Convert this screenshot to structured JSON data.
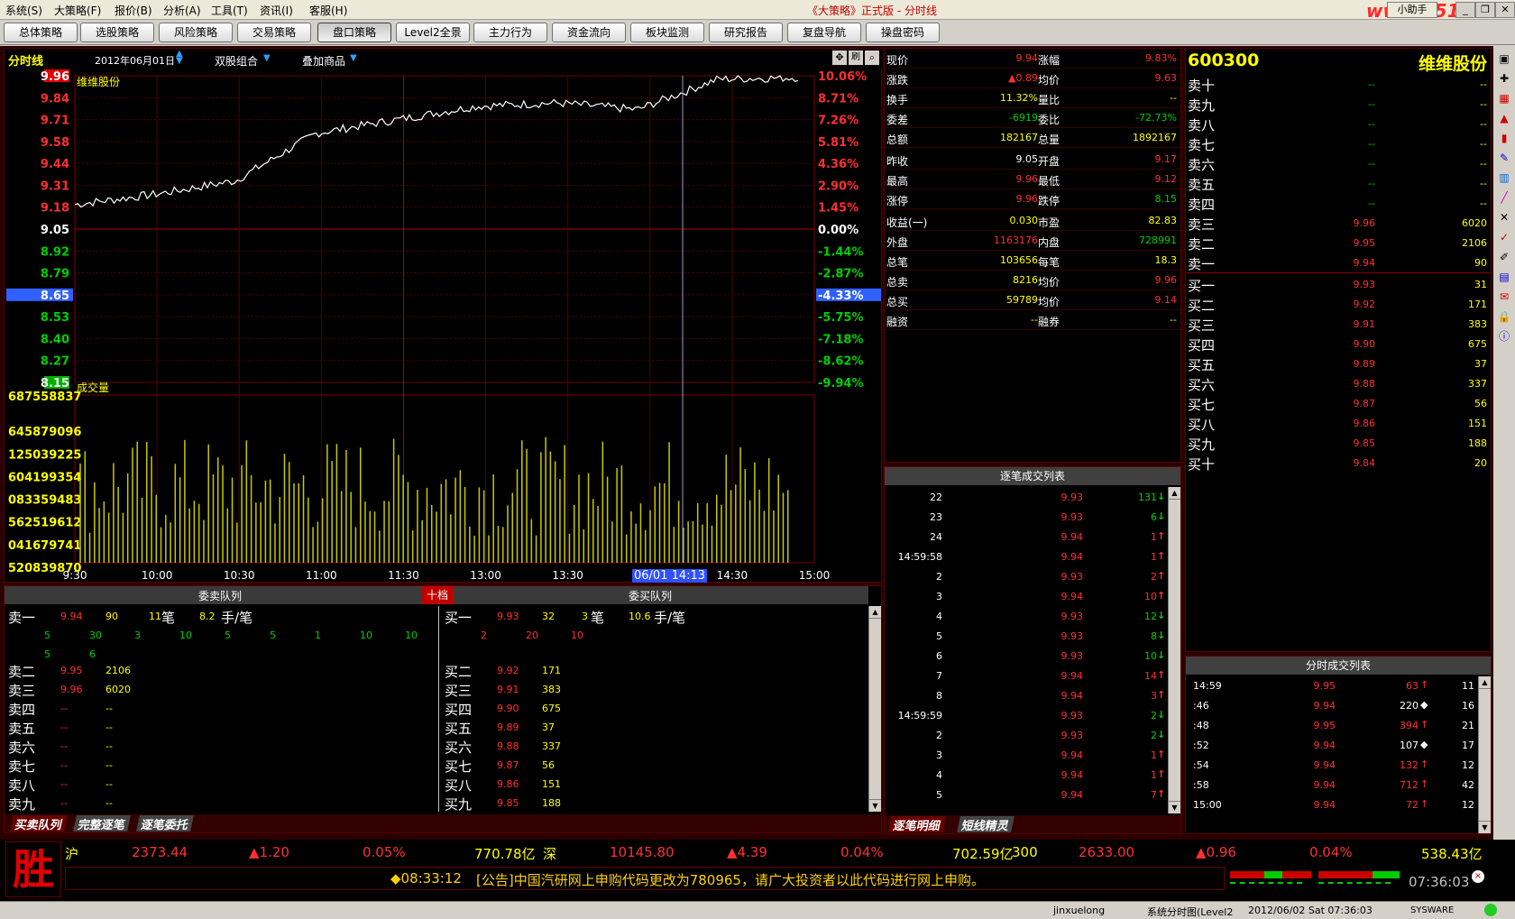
{
  "menu": [
    "系统(S)",
    "大策略(F)",
    "报价(B)",
    "分析(A)",
    "工具(T)",
    "资讯(I)",
    "客服(H)"
  ],
  "app_title": "《大策略》正式版 - 分时线",
  "logo_text": "www.55188.com",
  "helper_label": "小助手",
  "toolbar": [
    "总体策略",
    "选股策略",
    "风险策略",
    "交易策略",
    "盘口策略",
    "Level2全景",
    "主力行为",
    "资金流向",
    "板块监测",
    "研究报告",
    "复盘导航",
    "操盘密码"
  ],
  "toolbar_active": 4,
  "chart": {
    "tab": "分时线",
    "date": "2012年06月01日",
    "combo1": "双股组合",
    "combo2": "叠加商品",
    "stock_name": "维维股份",
    "volume_label": "成交量",
    "cursor_time": "06/01 14:13",
    "price_labels": [
      "9.96",
      "9.84",
      "9.71",
      "9.58",
      "9.44",
      "9.31",
      "9.18",
      "9.05",
      "8.92",
      "8.79",
      "8.65",
      "8.53",
      "8.40",
      "8.27",
      "8.15"
    ],
    "pct_labels": [
      "10.06%",
      "8.71%",
      "7.26%",
      "5.81%",
      "4.36%",
      "2.90%",
      "1.45%",
      "0.00%",
      "-1.44%",
      "-2.87%",
      "-4.33%",
      "-5.75%",
      "-7.18%",
      "-8.62%",
      "-9.94%"
    ],
    "vol_labels": [
      "687558837",
      "645879096",
      "125039225",
      "604199354",
      "083359483",
      "562519612",
      "041679741",
      "520839870"
    ],
    "time_labels": [
      "9:30",
      "10:00",
      "10:30",
      "11:00",
      "11:30",
      "13:00",
      "13:30",
      "14:00",
      "14:30",
      "15:00"
    ],
    "highlight_price": "8.65",
    "highlight_pct": "-4.33%"
  },
  "chart_data": {
    "type": "line",
    "title": "维维股份",
    "x": [
      "9:30",
      "10:00",
      "10:30",
      "11:00",
      "11:30",
      "13:00",
      "13:30",
      "14:00",
      "14:30",
      "15:00"
    ],
    "series": [
      {
        "values": [
          9.2,
          9.26,
          9.34,
          9.62,
          9.7,
          9.78,
          9.8,
          9.76,
          9.94,
          9.95
        ]
      }
    ],
    "ylim": [
      8.15,
      9.96
    ],
    "prev_close": 9.05,
    "volume_series": [
      {
        "name": "成交量"
      }
    ]
  },
  "orders": {
    "left_header": "委卖队列",
    "mid_label": "十档",
    "right_header": "委买队列",
    "sell1": {
      "label": "卖一",
      "price": "9.94",
      "vol": "90",
      "count": "11",
      "count_unit": "笔",
      "avg": "8.2",
      "avg_unit": "手/笔"
    },
    "sell1_queue1": [
      "5",
      "30",
      "3",
      "10",
      "5",
      "5",
      "1",
      "10",
      "10"
    ],
    "sell1_queue2": [
      "5",
      "6"
    ],
    "buy1": {
      "label": "买一",
      "price": "9.93",
      "vol": "32",
      "count": "3",
      "count_unit": "笔",
      "avg": "10.6",
      "avg_unit": "手/笔"
    },
    "buy1_queue": [
      "2",
      "20",
      "10"
    ],
    "sells": [
      {
        "label": "卖二",
        "price": "9.95",
        "vol": "2106"
      },
      {
        "label": "卖三",
        "price": "9.96",
        "vol": "6020"
      },
      {
        "label": "卖四",
        "price": "--",
        "vol": "--"
      },
      {
        "label": "卖五",
        "price": "--",
        "vol": "--"
      },
      {
        "label": "卖六",
        "price": "--",
        "vol": "--"
      },
      {
        "label": "卖七",
        "price": "--",
        "vol": "--"
      },
      {
        "label": "卖八",
        "price": "--",
        "vol": "--"
      },
      {
        "label": "卖九",
        "price": "--",
        "vol": "--"
      }
    ],
    "buys": [
      {
        "label": "买二",
        "price": "9.92",
        "vol": "171"
      },
      {
        "label": "买三",
        "price": "9.91",
        "vol": "383"
      },
      {
        "label": "买四",
        "price": "9.90",
        "vol": "675"
      },
      {
        "label": "买五",
        "price": "9.89",
        "vol": "37"
      },
      {
        "label": "买六",
        "price": "9.88",
        "vol": "337"
      },
      {
        "label": "买七",
        "price": "9.87",
        "vol": "56"
      },
      {
        "label": "买八",
        "price": "9.86",
        "vol": "151"
      },
      {
        "label": "买九",
        "price": "9.85",
        "vol": "188"
      }
    ],
    "tabs": [
      "买卖队列",
      "完整逐笔",
      "逐笔委托"
    ]
  },
  "quote": [
    {
      "l": "现价",
      "v1": "9.94",
      "c1": "red",
      "k": "涨幅",
      "v2": "9.83%",
      "c2": "red"
    },
    {
      "l": "涨跌",
      "v1": "▲0.89",
      "c1": "red",
      "k": "均价",
      "v2": "9.63",
      "c2": "red"
    },
    {
      "l": "换手",
      "v1": "11.32%",
      "c1": "yellow",
      "k": "量比",
      "v2": "--",
      "c2": "yellow"
    },
    {
      "l": "委差",
      "v1": "-6919",
      "c1": "green",
      "k": "委比",
      "v2": "-72.73%",
      "c2": "green"
    },
    {
      "l": "总额",
      "v1": "182167",
      "c1": "yellow",
      "k": "总量",
      "v2": "1892167",
      "c2": "yellow"
    },
    {
      "l": "昨收",
      "v1": "9.05",
      "c1": "white",
      "k": "开盘",
      "v2": "9.17",
      "c2": "red"
    },
    {
      "l": "最高",
      "v1": "9.96",
      "c1": "red",
      "k": "最低",
      "v2": "9.12",
      "c2": "red"
    },
    {
      "l": "涨停",
      "v1": "9.96",
      "c1": "red",
      "k": "跌停",
      "v2": "8.15",
      "c2": "green"
    },
    {
      "l": "收益(一)",
      "v1": "0.030",
      "c1": "yellow",
      "k": "市盈",
      "v2": "82.83",
      "c2": "yellow"
    },
    {
      "l": "外盘",
      "v1": "1163176",
      "c1": "red",
      "k": "内盘",
      "v2": "728991",
      "c2": "green"
    },
    {
      "l": "总笔",
      "v1": "103656",
      "c1": "yellow",
      "k": "每笔",
      "v2": "18.3",
      "c2": "yellow"
    },
    {
      "l": "总卖",
      "v1": "8216",
      "c1": "yellow",
      "k": "均价",
      "v2": "9.96",
      "c2": "red"
    },
    {
      "l": "总买",
      "v1": "59789",
      "c1": "yellow",
      "k": "均价",
      "v2": "9.14",
      "c2": "red"
    },
    {
      "l": "融资",
      "v1": "--",
      "c1": "yellow",
      "k": "融券",
      "v2": "--",
      "c2": "yellow"
    }
  ],
  "trades": {
    "title": "逐笔成交列表",
    "rows": [
      {
        "t": "22",
        "p": "9.93",
        "v": "131",
        "d": "↓",
        "dc": "green"
      },
      {
        "t": "23",
        "p": "9.93",
        "v": "6",
        "d": "↓",
        "dc": "green"
      },
      {
        "t": "24",
        "p": "9.94",
        "v": "1",
        "d": "↑",
        "dc": "red"
      },
      {
        "t": "14:59:58",
        "p": "9.94",
        "v": "1",
        "d": "↑",
        "dc": "red"
      },
      {
        "t": "2",
        "p": "9.93",
        "v": "2",
        "d": "↑",
        "dc": "red"
      },
      {
        "t": "3",
        "p": "9.94",
        "v": "10",
        "d": "↑",
        "dc": "red"
      },
      {
        "t": "4",
        "p": "9.93",
        "v": "12",
        "d": "↓",
        "dc": "green"
      },
      {
        "t": "5",
        "p": "9.93",
        "v": "8",
        "d": "↓",
        "dc": "green"
      },
      {
        "t": "6",
        "p": "9.93",
        "v": "10",
        "d": "↓",
        "dc": "green"
      },
      {
        "t": "7",
        "p": "9.94",
        "v": "14",
        "d": "↑",
        "dc": "red"
      },
      {
        "t": "8",
        "p": "9.94",
        "v": "3",
        "d": "↑",
        "dc": "red"
      },
      {
        "t": "14:59:59",
        "p": "9.93",
        "v": "2",
        "d": "↓",
        "dc": "green"
      },
      {
        "t": "2",
        "p": "9.93",
        "v": "2",
        "d": "↓",
        "dc": "green"
      },
      {
        "t": "3",
        "p": "9.94",
        "v": "1",
        "d": "↑",
        "dc": "red"
      },
      {
        "t": "4",
        "p": "9.94",
        "v": "1",
        "d": "↑",
        "dc": "red"
      },
      {
        "t": "5",
        "p": "9.94",
        "v": "7",
        "d": "↑",
        "dc": "red"
      }
    ],
    "tabs": [
      "逐笔明细",
      "短线精灵"
    ]
  },
  "book": {
    "code": "600300",
    "name": "维维股份",
    "rows": [
      {
        "l": "卖十",
        "p": "--",
        "v": "--"
      },
      {
        "l": "卖九",
        "p": "--",
        "v": "--"
      },
      {
        "l": "卖八",
        "p": "--",
        "v": "--"
      },
      {
        "l": "卖七",
        "p": "--",
        "v": "--"
      },
      {
        "l": "卖六",
        "p": "--",
        "v": "--"
      },
      {
        "l": "卖五",
        "p": "--",
        "v": "--"
      },
      {
        "l": "卖四",
        "p": "--",
        "v": "--"
      },
      {
        "l": "卖三",
        "p": "9.96",
        "v": "6020"
      },
      {
        "l": "卖二",
        "p": "9.95",
        "v": "2106"
      },
      {
        "l": "卖一",
        "p": "9.94",
        "v": "90"
      },
      {
        "l": "买一",
        "p": "9.93",
        "v": "31"
      },
      {
        "l": "买二",
        "p": "9.92",
        "v": "171"
      },
      {
        "l": "买三",
        "p": "9.91",
        "v": "383"
      },
      {
        "l": "买四",
        "p": "9.90",
        "v": "675"
      },
      {
        "l": "买五",
        "p": "9.89",
        "v": "37"
      },
      {
        "l": "买六",
        "p": "9.88",
        "v": "337"
      },
      {
        "l": "买七",
        "p": "9.87",
        "v": "56"
      },
      {
        "l": "买八",
        "p": "9.86",
        "v": "151"
      },
      {
        "l": "买九",
        "p": "9.85",
        "v": "188"
      },
      {
        "l": "买十",
        "p": "9.84",
        "v": "20"
      }
    ]
  },
  "minute": {
    "title": "分时成交列表",
    "rows": [
      {
        "t": "14:59",
        "p": "9.95",
        "v": "63",
        "d": "↑",
        "dc": "red",
        "n": "11"
      },
      {
        "t": ":46",
        "p": "9.94",
        "v": "220",
        "d": "◆",
        "dc": "white",
        "n": "16"
      },
      {
        "t": ":48",
        "p": "9.95",
        "v": "394",
        "d": "↑",
        "dc": "red",
        "n": "21"
      },
      {
        "t": ":52",
        "p": "9.94",
        "v": "107",
        "d": "◆",
        "dc": "white",
        "n": "17"
      },
      {
        "t": ":54",
        "p": "9.94",
        "v": "132",
        "d": "↑",
        "dc": "red",
        "n": "12"
      },
      {
        "t": ":58",
        "p": "9.94",
        "v": "712",
        "d": "↑",
        "dc": "red",
        "n": "42"
      },
      {
        "t": "15:00",
        "p": "9.94",
        "v": "72",
        "d": "↑",
        "dc": "red",
        "n": "12"
      }
    ]
  },
  "status": {
    "sh": {
      "label": "沪",
      "val": "2373.44",
      "chg": "▲1.20",
      "pct": "0.05%",
      "amt": "770.78亿"
    },
    "sz": {
      "label": "深",
      "val": "10145.80",
      "chg": "▲4.39",
      "pct": "0.04%",
      "amt": "702.59亿"
    },
    "cy": {
      "label": "300",
      "val": "2633.00",
      "chg": "▲0.96",
      "pct": "0.04%",
      "amt": "538.43亿"
    },
    "news_time": "◆08:33:12",
    "news": "[公告]中国汽研网上申购代码更改为780965，请广大投资者以此代码进行网上申购。",
    "clock": "07:36:03",
    "user": "jinxuelong",
    "mode": "系统分时图(Level2",
    "datetime": "2012/06/02 Sat 07:36:03",
    "brand": "SYSWARE"
  }
}
